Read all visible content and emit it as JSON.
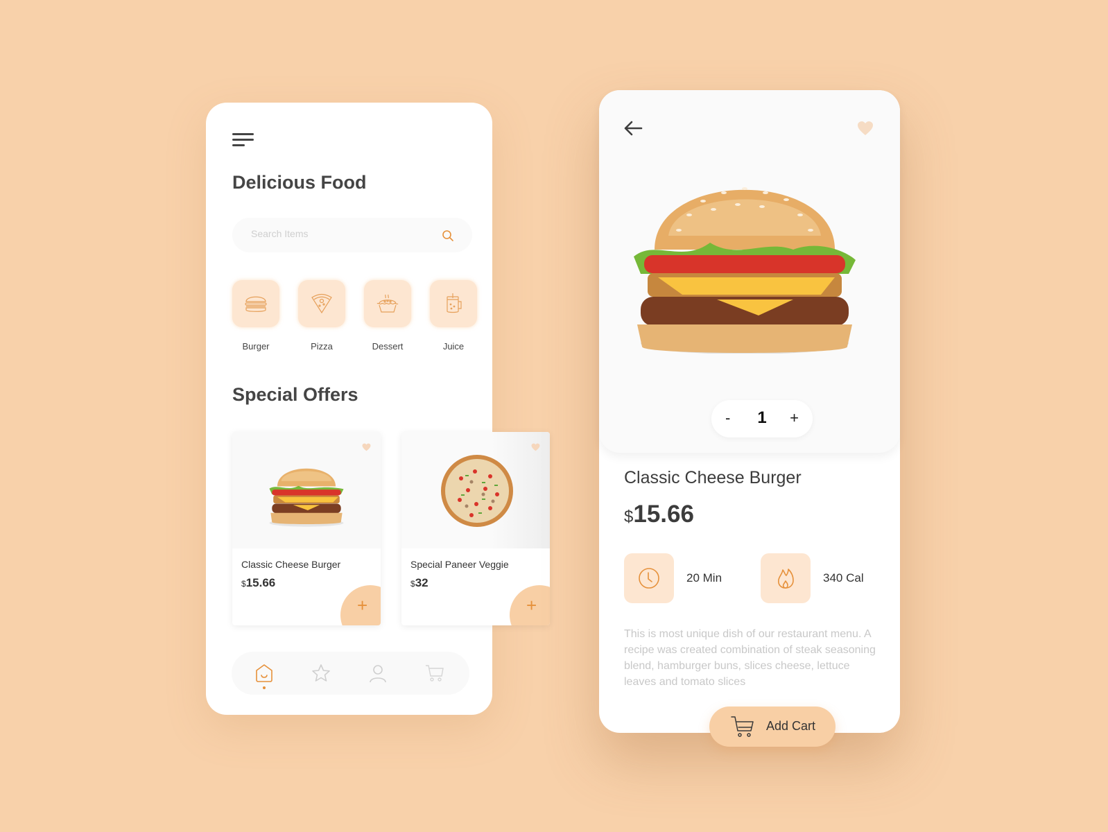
{
  "colors": {
    "background": "#f8d1aa",
    "accent": "#e6913b",
    "accent_soft": "#fde6d1",
    "button": "#f8cfa5"
  },
  "home": {
    "menu_icon": "hamburger-menu-icon",
    "title": "Delicious Food",
    "search": {
      "placeholder": "Search Items",
      "value": "",
      "icon": "search-icon"
    },
    "categories": [
      {
        "label": "Burger",
        "icon": "burger-icon"
      },
      {
        "label": "Pizza",
        "icon": "pizza-slice-icon"
      },
      {
        "label": "Dessert",
        "icon": "pie-icon"
      },
      {
        "label": "Juice",
        "icon": "juice-jar-icon"
      }
    ],
    "offers_title": "Special Offers",
    "offers": [
      {
        "name": "Classic Cheese Burger",
        "currency": "$",
        "price": "15.66",
        "add_label": "+",
        "image": "burger"
      },
      {
        "name": "Special Paneer Veggie",
        "currency": "$",
        "price": "32",
        "add_label": "+",
        "image": "pizza"
      }
    ],
    "nav": [
      {
        "name": "home",
        "icon": "home-icon",
        "active": true
      },
      {
        "name": "favorites",
        "icon": "star-icon",
        "active": false
      },
      {
        "name": "profile",
        "icon": "user-icon",
        "active": false
      },
      {
        "name": "cart",
        "icon": "cart-icon",
        "active": false
      }
    ]
  },
  "detail": {
    "back_icon": "arrow-left-icon",
    "favorite_icon": "heart-icon",
    "quantity": {
      "minus": "-",
      "value": "1",
      "plus": "+"
    },
    "name": "Classic Cheese Burger",
    "currency": "$",
    "price": "15.66",
    "time": "20 Min",
    "calories": "340 Cal",
    "description": "This is most unique dish of our restaurant menu. A recipe was created combination of steak seasoning blend, hamburger buns, slices cheese,  lettuce leaves and tomato slices",
    "add_cart_label": "Add Cart"
  }
}
